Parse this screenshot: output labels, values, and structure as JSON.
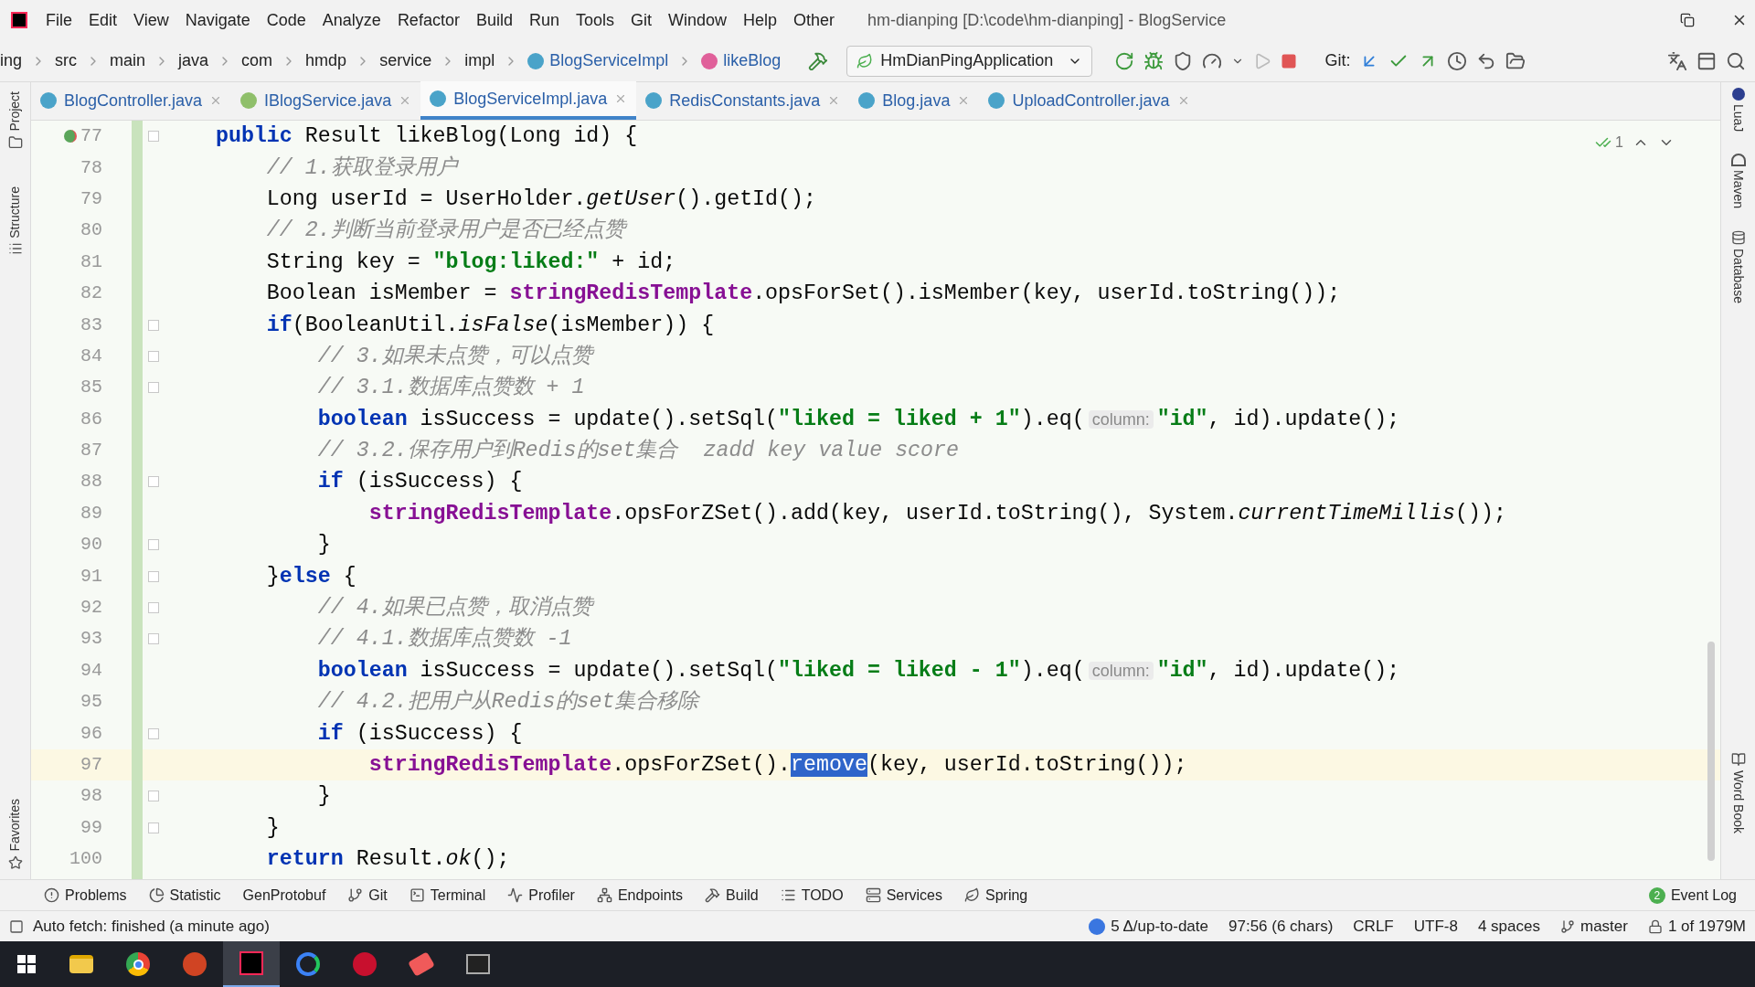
{
  "window": {
    "title": "hm-dianping [D:\\code\\hm-dianping] - BlogService",
    "menu": [
      "File",
      "Edit",
      "View",
      "Navigate",
      "Code",
      "Analyze",
      "Refactor",
      "Build",
      "Run",
      "Tools",
      "Git",
      "Window",
      "Help",
      "Other"
    ]
  },
  "breadcrumb": [
    {
      "label": "ing",
      "kind": "folder"
    },
    {
      "label": "src",
      "kind": "folder"
    },
    {
      "label": "main",
      "kind": "folder"
    },
    {
      "label": "java",
      "kind": "folder"
    },
    {
      "label": "com",
      "kind": "folder"
    },
    {
      "label": "hmdp",
      "kind": "folder"
    },
    {
      "label": "service",
      "kind": "folder"
    },
    {
      "label": "impl",
      "kind": "folder"
    },
    {
      "label": "BlogServiceImpl",
      "kind": "class"
    },
    {
      "label": "likeBlog",
      "kind": "method"
    }
  ],
  "run_config": {
    "label": "HmDianPingApplication"
  },
  "git_label": "Git:",
  "tabs": [
    {
      "label": "BlogController.java",
      "kind": "class",
      "selected": false
    },
    {
      "label": "IBlogService.java",
      "kind": "interface",
      "selected": false
    },
    {
      "label": "BlogServiceImpl.java",
      "kind": "class",
      "selected": true
    },
    {
      "label": "RedisConstants.java",
      "kind": "class",
      "selected": false
    },
    {
      "label": "Blog.java",
      "kind": "class",
      "selected": false
    },
    {
      "label": "UploadController.java",
      "kind": "class",
      "selected": false
    }
  ],
  "left_tools": [
    {
      "label": "Project",
      "kind": "folder"
    },
    {
      "label": "Structure",
      "kind": "structure"
    },
    {
      "label": "Favorites",
      "kind": "star"
    }
  ],
  "right_tools": [
    {
      "label": "LuaJ",
      "kind": "lua"
    },
    {
      "label": "Maven",
      "kind": "maven"
    },
    {
      "label": "Database",
      "kind": "database"
    },
    {
      "label": "Word Book",
      "kind": "book"
    }
  ],
  "editor": {
    "inspection_count": "1",
    "lines": [
      {
        "number": "77",
        "current": false,
        "fold": true,
        "implements_marker": true,
        "tokens": [
          {
            "kind": "k",
            "text": "    public"
          },
          {
            "kind": "p",
            "text": " Result likeBlog(Long id) {"
          }
        ]
      },
      {
        "number": "78",
        "current": false,
        "fold": false,
        "tokens": [
          {
            "kind": "c",
            "text": "        // 1.获取登录用户"
          }
        ]
      },
      {
        "number": "79",
        "current": false,
        "fold": false,
        "tokens": [
          {
            "kind": "p",
            "text": "        Long userId = UserHolder."
          },
          {
            "kind": "i",
            "text": "getUser"
          },
          {
            "kind": "p",
            "text": "().getId();"
          }
        ]
      },
      {
        "number": "80",
        "current": false,
        "fold": false,
        "tokens": [
          {
            "kind": "c",
            "text": "        // 2.判断当前登录用户是否已经点赞"
          }
        ]
      },
      {
        "number": "81",
        "current": false,
        "fold": false,
        "tokens": [
          {
            "kind": "p",
            "text": "        String key = "
          },
          {
            "kind": "s",
            "text": "\"blog:liked:\""
          },
          {
            "kind": "p",
            "text": " + id;"
          }
        ]
      },
      {
        "number": "82",
        "current": false,
        "fold": false,
        "tokens": [
          {
            "kind": "p",
            "text": "        Boolean isMember = "
          },
          {
            "kind": "f",
            "text": "stringRedisTemplate"
          },
          {
            "kind": "p",
            "text": ".opsForSet().isMember(key, userId.toString());"
          }
        ]
      },
      {
        "number": "83",
        "current": false,
        "fold": true,
        "tokens": [
          {
            "kind": "k",
            "text": "        if"
          },
          {
            "kind": "p",
            "text": "(BooleanUtil."
          },
          {
            "kind": "i",
            "text": "isFalse"
          },
          {
            "kind": "p",
            "text": "(isMember)) {"
          }
        ]
      },
      {
        "number": "84",
        "current": false,
        "fold": true,
        "tokens": [
          {
            "kind": "c",
            "text": "            // 3.如果未点赞，可以点赞"
          }
        ]
      },
      {
        "number": "85",
        "current": false,
        "fold": true,
        "tokens": [
          {
            "kind": "c",
            "text": "            // 3.1.数据库点赞数 + 1"
          }
        ]
      },
      {
        "number": "86",
        "current": false,
        "fold": false,
        "tokens": [
          {
            "kind": "k",
            "text": "            boolean"
          },
          {
            "kind": "p",
            "text": " isSuccess = update().setSql("
          },
          {
            "kind": "s",
            "text": "\"liked = liked + 1\""
          },
          {
            "kind": "p",
            "text": ").eq("
          },
          {
            "kind": "h",
            "text": "column:"
          },
          {
            "kind": "s",
            "text": "\"id\""
          },
          {
            "kind": "p",
            "text": ", id).update();"
          }
        ]
      },
      {
        "number": "87",
        "current": false,
        "fold": false,
        "tokens": [
          {
            "kind": "c",
            "text": "            // 3.2.保存用户到Redis的set集合  zadd key value score"
          }
        ]
      },
      {
        "number": "88",
        "current": false,
        "fold": true,
        "tokens": [
          {
            "kind": "k",
            "text": "            if"
          },
          {
            "kind": "p",
            "text": " (isSuccess) {"
          }
        ]
      },
      {
        "number": "89",
        "current": false,
        "fold": false,
        "tokens": [
          {
            "kind": "f",
            "text": "                stringRedisTemplate"
          },
          {
            "kind": "p",
            "text": ".opsForZSet().add(key, userId.toString(), System."
          },
          {
            "kind": "i",
            "text": "currentTimeMillis"
          },
          {
            "kind": "p",
            "text": "());"
          }
        ]
      },
      {
        "number": "90",
        "current": false,
        "fold": true,
        "tokens": [
          {
            "kind": "p",
            "text": "            }"
          }
        ]
      },
      {
        "number": "91",
        "current": false,
        "fold": true,
        "tokens": [
          {
            "kind": "p",
            "text": "        }"
          },
          {
            "kind": "k",
            "text": "else"
          },
          {
            "kind": "p",
            "text": " {"
          }
        ]
      },
      {
        "number": "92",
        "current": false,
        "fold": true,
        "tokens": [
          {
            "kind": "c",
            "text": "            // 4.如果已点赞，取消点赞"
          }
        ]
      },
      {
        "number": "93",
        "current": false,
        "fold": true,
        "tokens": [
          {
            "kind": "c",
            "text": "            // 4.1.数据库点赞数 -1"
          }
        ]
      },
      {
        "number": "94",
        "current": false,
        "fold": false,
        "tokens": [
          {
            "kind": "k",
            "text": "            boolean"
          },
          {
            "kind": "p",
            "text": " isSuccess = update().setSql("
          },
          {
            "kind": "s",
            "text": "\"liked = liked - 1\""
          },
          {
            "kind": "p",
            "text": ").eq("
          },
          {
            "kind": "h",
            "text": "column:"
          },
          {
            "kind": "s",
            "text": "\"id\""
          },
          {
            "kind": "p",
            "text": ", id).update();"
          }
        ]
      },
      {
        "number": "95",
        "current": false,
        "fold": false,
        "tokens": [
          {
            "kind": "c",
            "text": "            // 4.2.把用户从Redis的set集合移除"
          }
        ]
      },
      {
        "number": "96",
        "current": false,
        "fold": true,
        "tokens": [
          {
            "kind": "k",
            "text": "            if"
          },
          {
            "kind": "p",
            "text": " (isSuccess) {"
          }
        ]
      },
      {
        "number": "97",
        "current": true,
        "fold": false,
        "tokens": [
          {
            "kind": "f",
            "text": "                stringRedisTemplate"
          },
          {
            "kind": "p",
            "text": ".opsForZSet()."
          },
          {
            "kind": "sel",
            "text": "remove"
          },
          {
            "kind": "p",
            "text": "(key, userId.toString());"
          }
        ]
      },
      {
        "number": "98",
        "current": false,
        "fold": true,
        "tokens": [
          {
            "kind": "p",
            "text": "            }"
          }
        ]
      },
      {
        "number": "99",
        "current": false,
        "fold": true,
        "tokens": [
          {
            "kind": "p",
            "text": "        }"
          }
        ]
      },
      {
        "number": "100",
        "current": false,
        "fold": false,
        "tokens": [
          {
            "kind": "k",
            "text": "        return"
          },
          {
            "kind": "p",
            "text": " Result."
          },
          {
            "kind": "i",
            "text": "ok"
          },
          {
            "kind": "p",
            "text": "();"
          }
        ]
      }
    ]
  },
  "tool_windows": [
    {
      "label": "Problems",
      "kind": "problems"
    },
    {
      "label": "Statistic",
      "kind": "statistic"
    },
    {
      "label": "GenProtobuf",
      "kind": "none"
    },
    {
      "label": "Git",
      "kind": "git"
    },
    {
      "label": "Terminal",
      "kind": "terminal"
    },
    {
      "label": "Profiler",
      "kind": "profiler"
    },
    {
      "label": "Endpoints",
      "kind": "endpoints"
    },
    {
      "label": "Build",
      "kind": "build"
    },
    {
      "label": "TODO",
      "kind": "todo"
    },
    {
      "label": "Services",
      "kind": "services"
    },
    {
      "label": "Spring",
      "kind": "spring"
    }
  ],
  "event_log": {
    "label": "Event Log",
    "badge": "2"
  },
  "status_bar": {
    "message": "Auto fetch: finished (a minute ago)",
    "items": [
      {
        "label": "5 Δ/up-to-date",
        "kind": "vcs"
      },
      {
        "label": "97:56 (6 chars)",
        "kind": "text"
      },
      {
        "label": "CRLF",
        "kind": "text"
      },
      {
        "label": "UTF-8",
        "kind": "text"
      },
      {
        "label": "4 spaces",
        "kind": "text"
      },
      {
        "label": "master",
        "kind": "branch"
      },
      {
        "label": "1 of 1979M",
        "kind": "memory"
      }
    ]
  },
  "taskbar": {
    "apps": [
      {
        "kind": "explorer",
        "selected": false
      },
      {
        "kind": "chrome",
        "selected": false
      },
      {
        "kind": "powerpoint",
        "selected": false
      },
      {
        "kind": "intellij",
        "selected": true
      },
      {
        "kind": "ring",
        "selected": false
      },
      {
        "kind": "redis",
        "selected": false
      },
      {
        "kind": "eraser",
        "selected": false
      },
      {
        "kind": "terminal",
        "selected": false
      }
    ]
  }
}
